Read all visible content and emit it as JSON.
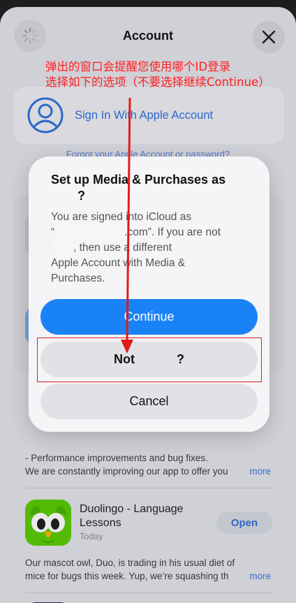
{
  "sheet": {
    "title": "Account",
    "sign_in_label": "Sign In With Apple Account",
    "forgot_link": "Forgot your Apple Account or password?"
  },
  "dialog": {
    "title_line1": "Set up Media & Purchases as",
    "title_line2": "?",
    "body_line1": "You are signed into iCloud as",
    "body_line2_prefix": "“",
    "body_line2_suffix": ".com”. If you are not",
    "body_line3_suffix": ", then use a different",
    "body_line4": "Apple Account with Media &",
    "body_line5": "Purchases.",
    "continue_label": "Continue",
    "not_label_prefix": "Not",
    "not_label_suffix": "?",
    "cancel_label": "Cancel"
  },
  "updates": {
    "line1": "- Performance improvements and bug fixes.",
    "line2": "We are constantly improving our app to offer you",
    "more": "more"
  },
  "app": {
    "name_line1": "Duolingo - Language",
    "name_line2": "Lessons",
    "subtitle": "Today",
    "open_label": "Open",
    "notes_line1": "Our mascot owl, Duo, is trading in his usual diet of",
    "notes_line2": "mice for bugs this week. Yup, we’re squashing th",
    "more": "more"
  },
  "annotation": {
    "line1": "弹出的窗口会提醒您使用哪个ID登录",
    "line2": "选择如下的选项（不要选择继续Continue）"
  },
  "colors": {
    "accent": "#1a82f7",
    "annotation_red": "#ff2020",
    "duolingo_green": "#58cc02"
  }
}
